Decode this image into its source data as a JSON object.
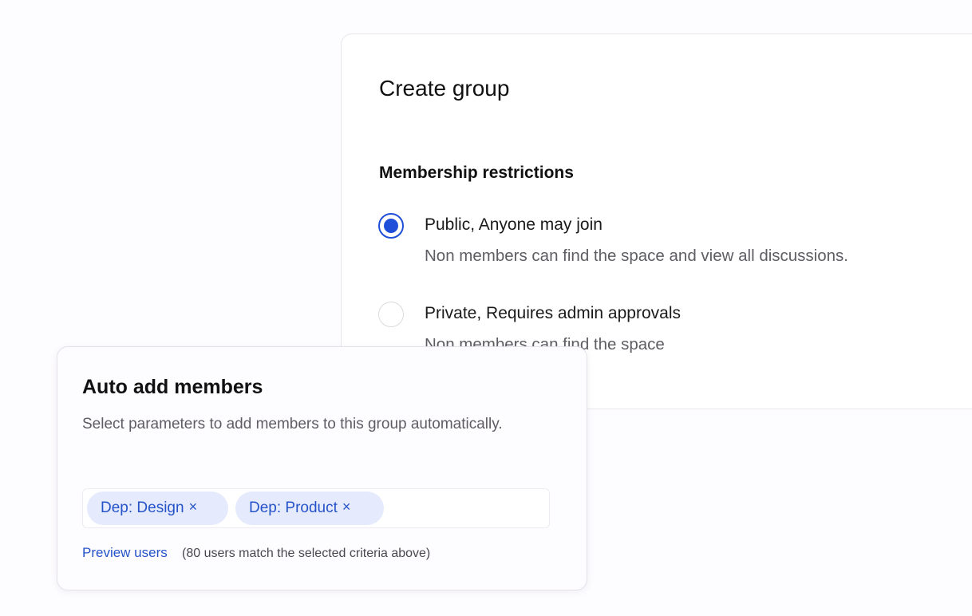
{
  "create_group": {
    "title": "Create group",
    "section_title": "Membership restrictions",
    "options": [
      {
        "label": "Public, Anyone may join",
        "description": "Non members can find the space and view all discussions.",
        "selected": true
      },
      {
        "label": "Private, Requires admin approvals",
        "description": "Non members can find the space",
        "selected": false
      }
    ]
  },
  "auto_add": {
    "title": "Auto add members",
    "description": "Select parameters to add members to this group automatically.",
    "tags": [
      {
        "label": "Dep: Design",
        "remove_icon": "×"
      },
      {
        "label": "Dep: Product",
        "remove_icon": "×"
      }
    ],
    "preview_link": "Preview users",
    "match_text": "(80 users match the selected criteria above)"
  },
  "colors": {
    "accent": "#1f4fd8",
    "chip_bg": "#e5eafc",
    "chip_text": "#2553c8"
  }
}
